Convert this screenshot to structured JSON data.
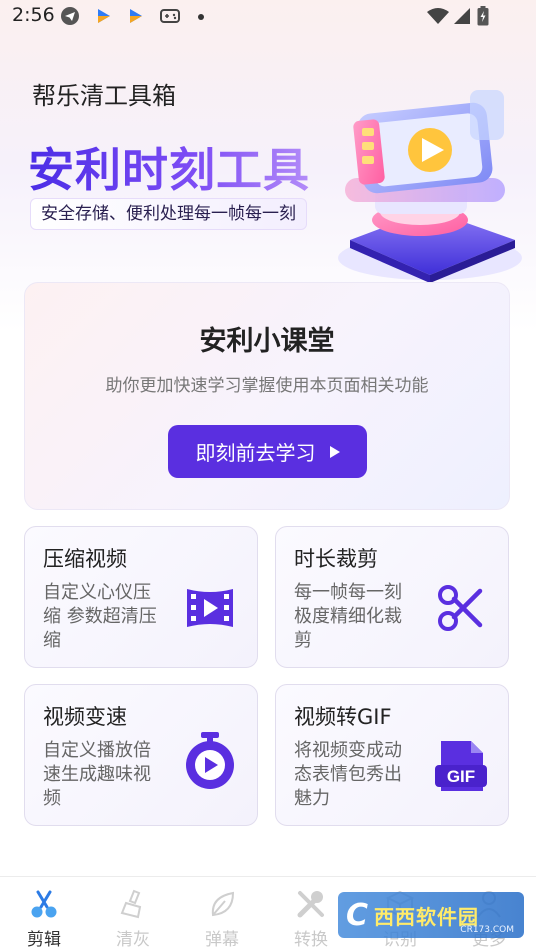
{
  "status_bar": {
    "time": "2:56",
    "icons_left": [
      "telegram-icon",
      "app-arrow-icon",
      "app-arrow-icon",
      "gamepad-icon",
      "dot-icon"
    ],
    "icons_right": [
      "wifi-icon",
      "signal-icon",
      "battery-charging-icon"
    ]
  },
  "app": {
    "title": "帮乐清工具箱"
  },
  "banner": {
    "title": "安利时刻工具",
    "subtitle": "安全存储、便利处理每一帧每一刻",
    "accent_color": "#5a2fe0"
  },
  "lesson": {
    "title": "安利小课堂",
    "description": "助你更加快速学习掌握使用本页面相关功能",
    "button_label": "即刻前去学习"
  },
  "features": [
    {
      "title": "压缩视频",
      "description": "自定义心仪压缩 参数超清压缩",
      "icon": "film-play-icon"
    },
    {
      "title": "时长裁剪",
      "description": "每一帧每一刻极度精细化裁剪",
      "icon": "scissors-icon"
    },
    {
      "title": "视频变速",
      "description": "自定义播放倍速生成趣味视频",
      "icon": "stopwatch-play-icon"
    },
    {
      "title": "视频转GIF",
      "description": "将视频变成动态表情包秀出魅力",
      "icon": "gif-file-icon"
    }
  ],
  "bottom_nav": [
    {
      "label": "剪辑",
      "icon": "scissors-icon",
      "active": true
    },
    {
      "label": "清灰",
      "icon": "brush-icon",
      "active": false
    },
    {
      "label": "弹幕",
      "icon": "leaf-icon",
      "active": false
    },
    {
      "label": "转换",
      "icon": "tools-icon",
      "active": false
    },
    {
      "label": "识别",
      "icon": "cube-icon",
      "active": false
    },
    {
      "label": "更多",
      "icon": "person-icon",
      "active": false
    }
  ],
  "watermark": {
    "text": "西西软件园",
    "sub": "CR173.COM"
  }
}
